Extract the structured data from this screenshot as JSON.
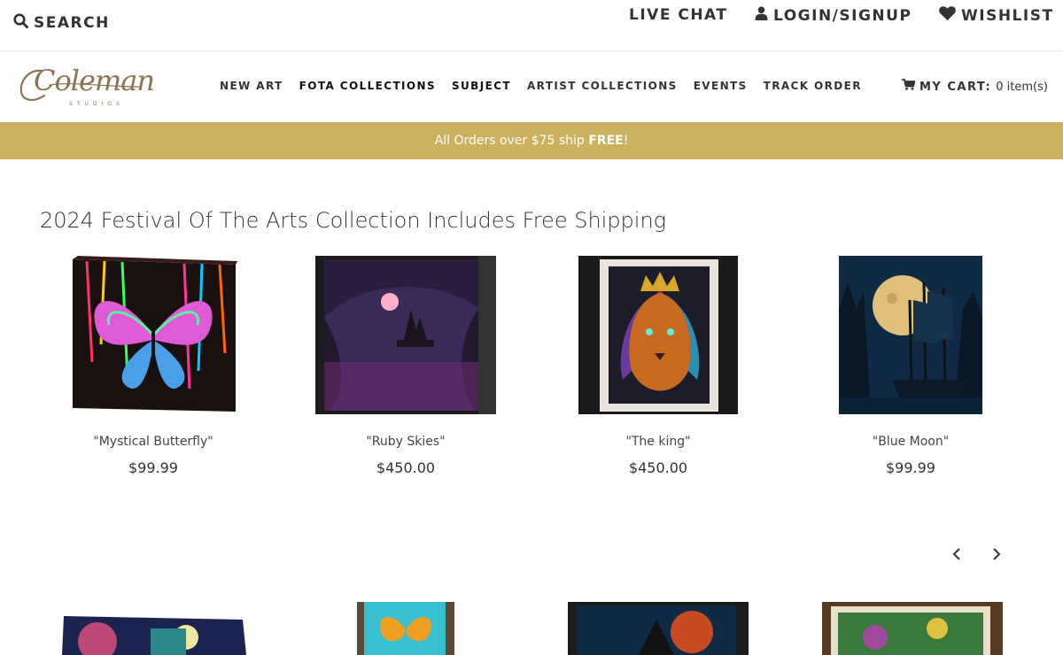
{
  "topbar": {
    "search_label": "SEARCH",
    "search_icon": "search-icon",
    "live_chat_label": "LIVE CHAT",
    "login_label": "LOGIN/SIGNUP",
    "login_icon": "user-icon",
    "wishlist_label": "WISHLIST",
    "wishlist_icon": "heart-icon"
  },
  "logo": {
    "word": "Coleman",
    "sub": "STUDIOS"
  },
  "nav": {
    "items": [
      {
        "label": "NEW ART"
      },
      {
        "label": "FOTA COLLECTIONS"
      },
      {
        "label": "SUBJECT"
      },
      {
        "label": "ARTIST COLLECTIONS"
      },
      {
        "label": "EVENTS"
      },
      {
        "label": "TRACK ORDER"
      }
    ],
    "cart_label": "MY CART:",
    "cart_count": "0 item(s)",
    "cart_icon": "cart-icon"
  },
  "banner": {
    "prefix": "All Orders over $75 ship ",
    "emphasis": "FREE",
    "suffix": "!"
  },
  "section": {
    "title": "2024 Festival Of The Arts Collection Includes Free Shipping"
  },
  "products": [
    {
      "name": "\"Mystical Butterfly\"",
      "price": "$99.99"
    },
    {
      "name": "\"Ruby Skies\"",
      "price": "$450.00"
    },
    {
      "name": "\"The king\"",
      "price": "$450.00"
    },
    {
      "name": "\"Blue Moon\"",
      "price": "$99.99"
    }
  ],
  "carousel": {
    "prev_icon": "chevron-left-icon",
    "next_icon": "chevron-right-icon"
  },
  "colors": {
    "accent": "#cdb05e",
    "logo": "#8a7552",
    "text": "#333333"
  }
}
